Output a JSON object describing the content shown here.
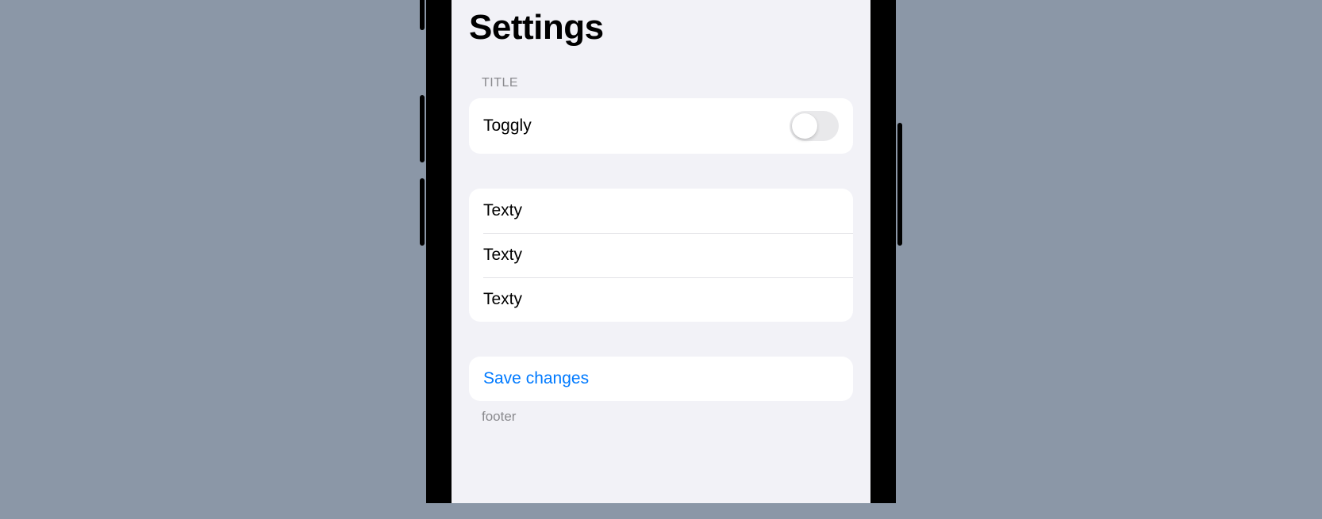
{
  "page": {
    "title": "Settings"
  },
  "sections": {
    "toggle": {
      "header": "TITLE",
      "row_label": "Toggly",
      "toggle_on": false
    },
    "list": {
      "items": [
        "Texty",
        "Texty",
        "Texty"
      ]
    },
    "action": {
      "button_label": "Save changes",
      "footer": "footer"
    }
  },
  "colors": {
    "background": "#f2f2f7",
    "card": "#ffffff",
    "accent": "#007aff",
    "secondary_text": "#8a8a8e",
    "toggle_off_track": "#e9e9eb",
    "page_bg": "#8b97a7"
  }
}
